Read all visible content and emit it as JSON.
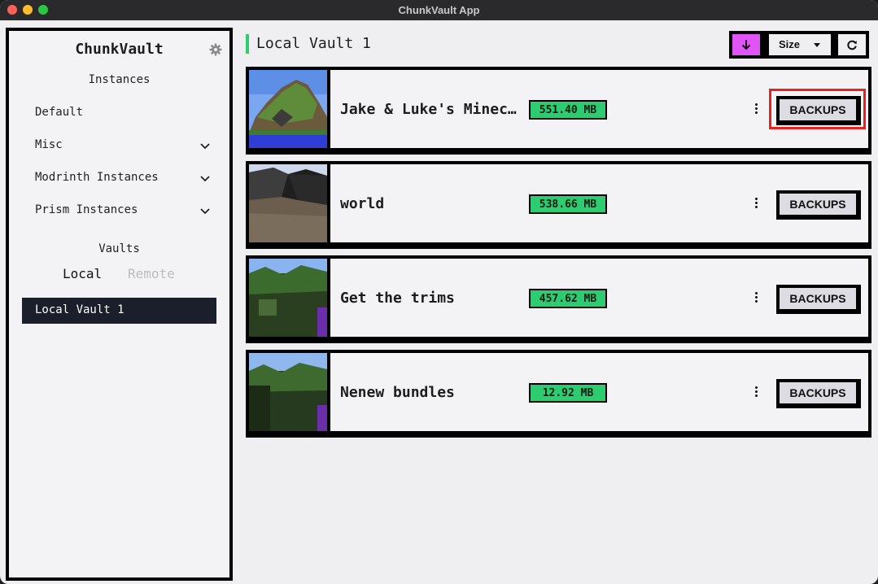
{
  "window": {
    "title": "ChunkVault App"
  },
  "sidebar": {
    "brand": "ChunkVault",
    "instances_label": "Instances",
    "items": [
      {
        "label": "Default",
        "expandable": false
      },
      {
        "label": "Misc",
        "expandable": true
      },
      {
        "label": "Modrinth Instances",
        "expandable": true
      },
      {
        "label": "Prism Instances",
        "expandable": true
      }
    ],
    "vaults_label": "Vaults",
    "vault_tabs": {
      "local": "Local",
      "remote": "Remote"
    },
    "vaults": [
      {
        "label": "Local Vault 1",
        "selected": true
      }
    ]
  },
  "main": {
    "title": "Local Vault 1",
    "toolbar": {
      "sort_label": "Size",
      "sort_icon": "arrow-down-icon",
      "refresh_icon": "refresh-icon"
    },
    "worlds": [
      {
        "name": "Jake & Luke's Minec…",
        "size": "551.40 MB",
        "backups_label": "BACKUPS"
      },
      {
        "name": "world",
        "size": "538.66 MB",
        "backups_label": "BACKUPS"
      },
      {
        "name": "Get the trims",
        "size": "457.62 MB",
        "backups_label": "BACKUPS"
      },
      {
        "name": "Nenew bundles",
        "size": "12.92 MB",
        "backups_label": "BACKUPS"
      }
    ]
  },
  "colors": {
    "accent": "#2ecc71",
    "sort_button": "#e055f5",
    "selected_vault": "#1b1f2b",
    "highlight": "#e8221f"
  }
}
